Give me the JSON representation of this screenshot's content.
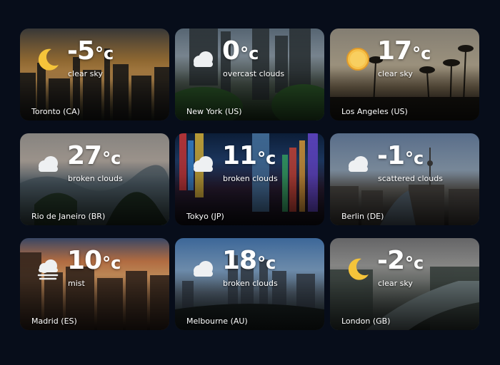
{
  "cards": [
    {
      "city": "Toronto (CA)",
      "temp": "-5",
      "unit": "°c",
      "desc": "clear sky",
      "icon": "moon-icon",
      "colors": {
        "sky_top": "#3a3a3a",
        "sky_mid": "#a87a3a",
        "sky_low": "#d9a25a",
        "ground": "#1c2420"
      }
    },
    {
      "city": "New York (US)",
      "temp": "0",
      "unit": "°c",
      "desc": "overcast clouds",
      "icon": "cloud-icon",
      "colors": {
        "sky_top": "#5a6a78",
        "sky_mid": "#8a98a4",
        "sky_low": "#4e5a52",
        "ground": "#1f3a1e"
      }
    },
    {
      "city": "Los Angeles (US)",
      "temp": "17",
      "unit": "°c",
      "desc": "clear sky",
      "icon": "sun-icon",
      "colors": {
        "sky_top": "#8a8478",
        "sky_mid": "#b9ad95",
        "sky_low": "#7a6a52",
        "ground": "#1a1712"
      }
    },
    {
      "city": "Rio de Janeiro (BR)",
      "temp": "27",
      "unit": "°c",
      "desc": "broken clouds",
      "icon": "cloud-icon",
      "colors": {
        "sky_top": "#8d8a86",
        "sky_mid": "#b3a9a0",
        "sky_low": "#5d6d78",
        "ground": "#263a2a"
      }
    },
    {
      "city": "Tokyo (JP)",
      "temp": "11",
      "unit": "°c",
      "desc": "broken clouds",
      "icon": "cloud-icon",
      "colors": {
        "sky_top": "#0c1f3a",
        "sky_mid": "#1f3d6a",
        "sky_low": "#2a1d33",
        "ground": "#120f18"
      }
    },
    {
      "city": "Berlin (DE)",
      "temp": "-1",
      "unit": "°c",
      "desc": "scattered clouds",
      "icon": "cloud-icon",
      "colors": {
        "sky_top": "#5c7290",
        "sky_mid": "#8fa2b6",
        "sky_low": "#6b6a66",
        "ground": "#2a2724"
      }
    },
    {
      "city": "Madrid (ES)",
      "temp": "10",
      "unit": "°c",
      "desc": "mist",
      "icon": "mist-icon",
      "colors": {
        "sky_top": "#3b4a6a",
        "sky_mid": "#c97a4a",
        "sky_low": "#e0a065",
        "ground": "#2a1e18"
      }
    },
    {
      "city": "Melbourne (AU)",
      "temp": "18",
      "unit": "°c",
      "desc": "broken clouds",
      "icon": "cloud-icon",
      "colors": {
        "sky_top": "#3f6ca0",
        "sky_mid": "#7fa3c8",
        "sky_low": "#586878",
        "ground": "#1f2a2a"
      }
    },
    {
      "city": "London (GB)",
      "temp": "-2",
      "unit": "°c",
      "desc": "clear sky",
      "icon": "moon-icon",
      "colors": {
        "sky_top": "#6a6a6c",
        "sky_mid": "#9a9a98",
        "sky_low": "#6e7470",
        "ground": "#26302c"
      }
    }
  ]
}
